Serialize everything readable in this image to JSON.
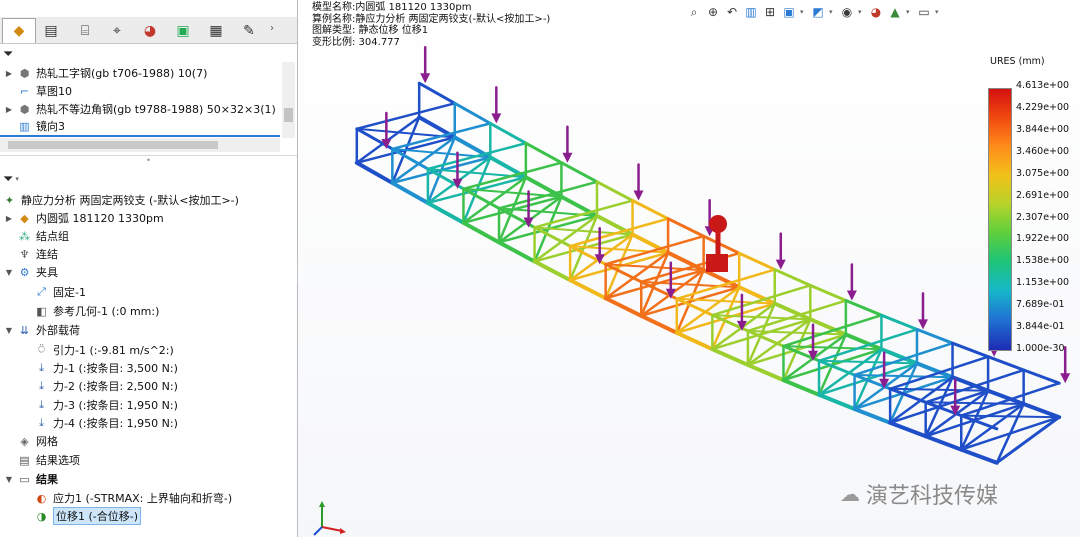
{
  "left_panel": {
    "tabs": [
      {
        "name": "feature-manager-tab",
        "glyph": "◆"
      },
      {
        "name": "property-manager-tab",
        "glyph": "▤"
      },
      {
        "name": "configuration-manager-tab",
        "glyph": "⌸"
      },
      {
        "name": "dimxpert-tab",
        "glyph": "⌖"
      },
      {
        "name": "display-manager-tab",
        "glyph": "◕"
      },
      {
        "name": "simulation-study-tab",
        "glyph": "▣"
      },
      {
        "name": "mbd-tab",
        "glyph": "▦"
      },
      {
        "name": "custom-tab",
        "glyph": "✎"
      }
    ],
    "top_tree": [
      "热轧工字钢(gb t706-1988) 10(7)",
      "草图10",
      "热轧不等边角钢(gb t9788-1988) 50×32×3(1)",
      "镜向3"
    ],
    "study_tree": {
      "root": "静应力分析 两固定两铰支 (-默认<按加工>-)",
      "part": "内圆弧 181120 1330pm",
      "connections_group": "结点组",
      "connectors": "连结",
      "fixtures": "夹具",
      "fixture_items": [
        "固定-1",
        "参考几何-1 (:0 mm:)"
      ],
      "loads": "外部载荷",
      "load_items": [
        "引力-1 (:-9.81 m/s^2:)",
        "力-1 (:按条目: 3,500 N:)",
        "力-2 (:按条目: 2,500 N:)",
        "力-3 (:按条目: 1,950 N:)",
        "力-4 (:按条目: 1,950 N:)"
      ],
      "mesh": "网格",
      "result_options": "结果选项",
      "results": "结果",
      "result_items": [
        "应力1 (-STRMAX: 上界轴向和折弯-)",
        "位移1 (-合位移-)"
      ]
    }
  },
  "viewport": {
    "info": {
      "model_name": "模型名称:内圆弧  181120 1330pm",
      "study_name": "算例名称:静应力分析  两固定两铰支(-默认<按加工>-)",
      "plot_type": "图解类型: 静态位移 位移1",
      "deformation_scale": "变形比例: 304.777"
    },
    "legend": {
      "title": "URES (mm)",
      "ticks": [
        "4.613e+00",
        "4.229e+00",
        "3.844e+00",
        "3.460e+00",
        "3.075e+00",
        "2.691e+00",
        "2.307e+00",
        "1.922e+00",
        "1.538e+00",
        "1.153e+00",
        "7.689e-01",
        "3.844e-01",
        "1.000e-30"
      ]
    },
    "watermark": "演艺科技传媒"
  },
  "toolbar_icons": [
    "zoom-to-fit",
    "zoom-area",
    "previous-view",
    "section-view",
    "dynamic-annotation",
    "view-orientation",
    "display-style",
    "hide-show",
    "edit-appearance",
    "apply-scene",
    "view-settings",
    "display-monitor"
  ],
  "colors": {
    "accent": "#2c7bd2",
    "selection": "#cde6fb",
    "load_arrow": "#8b1e8f",
    "fixture_marker": "#c81818"
  }
}
